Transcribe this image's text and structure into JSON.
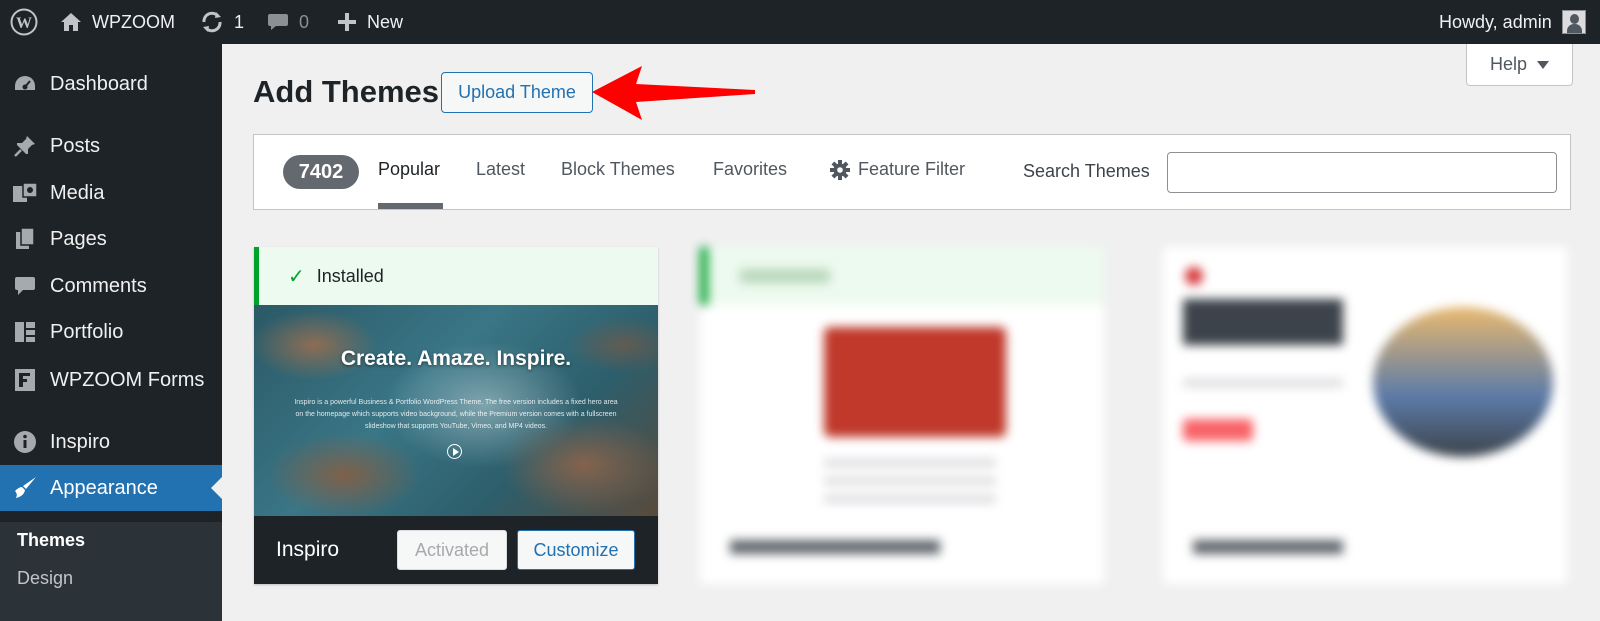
{
  "adminbar": {
    "site_name": "WPZOOM",
    "updates_count": "1",
    "comments_count": "0",
    "new_label": "New",
    "greeting": "Howdy, admin"
  },
  "sidebar": {
    "items": [
      {
        "label": "Dashboard",
        "icon": "dashboard-icon"
      },
      {
        "label": "Posts",
        "icon": "pin-icon"
      },
      {
        "label": "Media",
        "icon": "media-icon"
      },
      {
        "label": "Pages",
        "icon": "pages-icon"
      },
      {
        "label": "Comments",
        "icon": "comment-icon"
      },
      {
        "label": "Portfolio",
        "icon": "portfolio-icon"
      },
      {
        "label": "WPZOOM Forms",
        "icon": "forms-icon"
      },
      {
        "label": "Inspiro",
        "icon": "info-icon"
      },
      {
        "label": "Appearance",
        "icon": "brush-icon"
      }
    ],
    "submenu": [
      "Themes",
      "Design"
    ]
  },
  "header": {
    "title": "Add Themes",
    "upload_label": "Upload Theme",
    "help_label": "Help"
  },
  "filter": {
    "count": "7402",
    "tabs": [
      "Popular",
      "Latest",
      "Block Themes",
      "Favorites"
    ],
    "feature_filter": "Feature Filter",
    "search_label": "Search Themes",
    "search_value": ""
  },
  "themes": [
    {
      "status": "Installed",
      "name": "Inspiro",
      "screenshot_title": "Create. Amaze. Inspire.",
      "screenshot_desc": "Inspiro is a powerful Business & Portfolio WordPress Theme. The free version includes a fixed hero area on the homepage which supports video background, while the Premium version comes with a fullscreen slideshow that supports YouTube, Vimeo, and MP4 videos.",
      "activated_label": "Activated",
      "customize_label": "Customize"
    }
  ],
  "colors": {
    "accent": "#2271b1",
    "success": "#00a32a",
    "adminbar": "#1d2327",
    "annotation_arrow": "#ff0000"
  }
}
